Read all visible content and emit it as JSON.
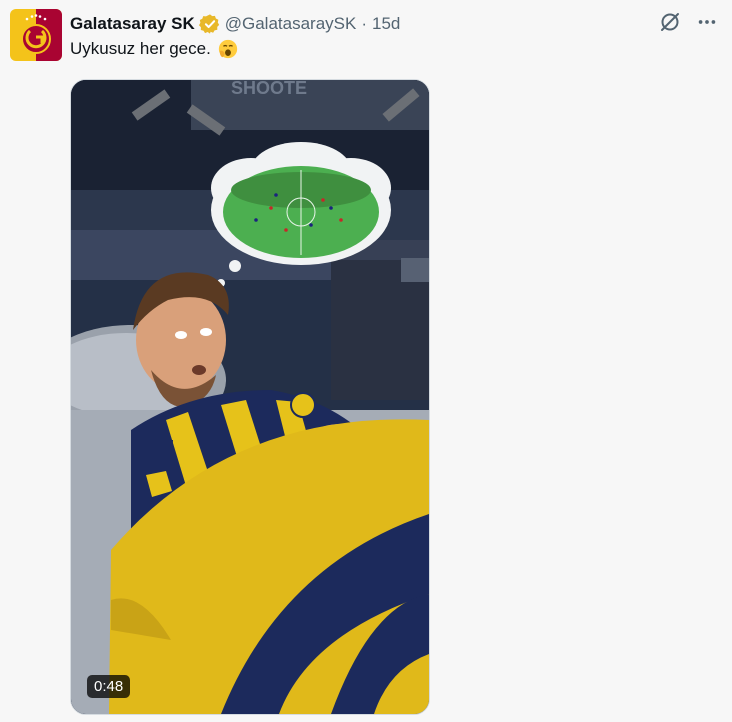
{
  "tweet": {
    "display_name": "Galatasaray SK",
    "handle": "@GalatasaraySK",
    "separator": "·",
    "time": "15d",
    "text": "Uykusuz her gece.",
    "emoji": "yawning-face-icon"
  },
  "media": {
    "duration": "0:48",
    "wall_sign": "SHOOTE"
  },
  "colors": {
    "club_red": "#a90432",
    "club_yellow": "#fdb912",
    "kit_navy": "#1c2a5c",
    "kit_yellow": "#e6c21a",
    "verified_gold": "#e8b829"
  }
}
